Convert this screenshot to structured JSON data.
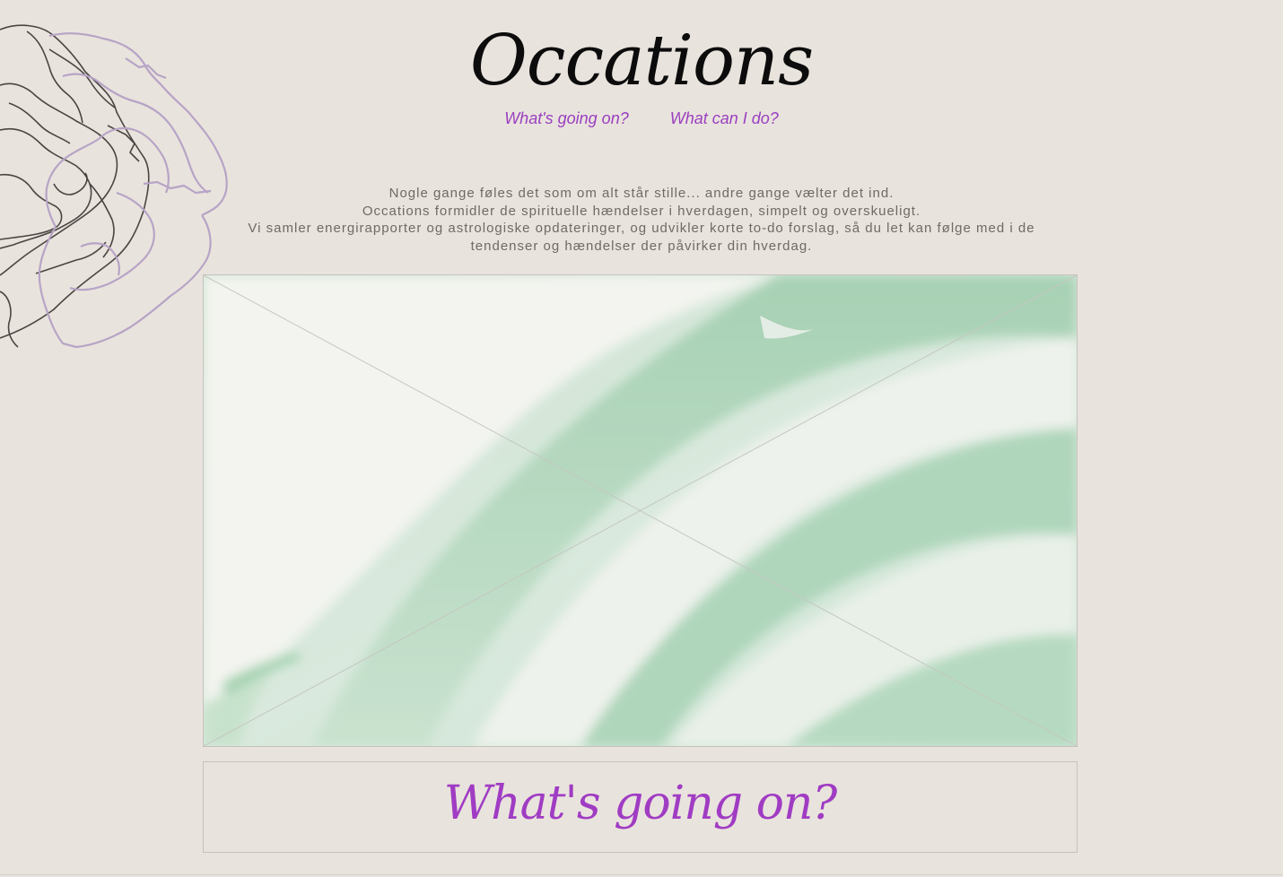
{
  "site": {
    "title": "Occations"
  },
  "nav": {
    "items": [
      {
        "label": "What's going on?"
      },
      {
        "label": "What can I do?"
      }
    ]
  },
  "intro": {
    "lines": [
      "Nogle gange føles det som om alt står stille... andre gange vælter det ind.",
      "Occations formidler de spirituelle hændelser i hverdagen, simpelt og overskueligt.",
      "Vi samler energirapporter og astrologiske opdateringer, og udvikler korte to-do forslag, så du let kan følge med i de tendenser og hændelser der påvirker din hverdag."
    ]
  },
  "section": {
    "heading": "What's going on?"
  },
  "colors": {
    "background": "#e9e3dd",
    "accent": "#9a40c0",
    "heading_accent": "#a03cc3",
    "body_text": "#6f6a66",
    "flower_outline_dark": "#4a4542",
    "flower_outline_lilac": "#b7a4c6",
    "hero_mint": "#a9d4b5"
  },
  "icons": {
    "decoration": "flower-outline-icon",
    "hero_placeholder": "image-placeholder-cross-icon"
  }
}
